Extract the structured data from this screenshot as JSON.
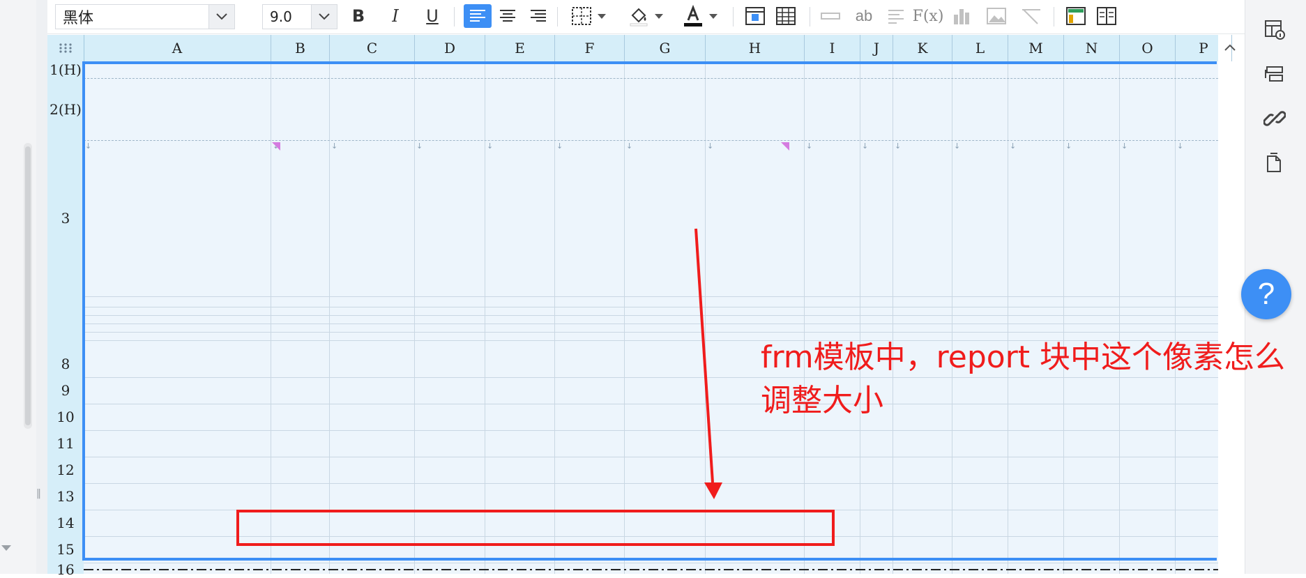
{
  "toolbar": {
    "font_family": "黑体",
    "font_size": "9.0",
    "buttons": [
      "bold",
      "italic",
      "underline",
      "align-left",
      "align-center",
      "align-right",
      "border",
      "fill-color",
      "font-color",
      "insert-cell",
      "table-grid",
      "merge",
      "text",
      "paragraph",
      "formula",
      "chart",
      "image",
      "slash",
      "layout-a",
      "layout-b"
    ]
  },
  "colors": {
    "accent": "#3d8ff5",
    "annotation": "#f01c1c",
    "header_bg": "#d6eef9",
    "cell_bg": "#edf5fc"
  },
  "grid": {
    "columns": [
      "A",
      "B",
      "C",
      "D",
      "E",
      "F",
      "G",
      "H",
      "I",
      "J",
      "K",
      "L",
      "M",
      "N",
      "O",
      "P"
    ],
    "rows": [
      "1(H)",
      "2(H)",
      "3",
      "8",
      "9",
      "10",
      "11",
      "12",
      "13",
      "14",
      "15",
      "16"
    ]
  },
  "annotation": {
    "text": "frm模板中，report 块中这个像素怎么调整大小"
  },
  "help": {
    "label": "?"
  },
  "right_panel": {
    "icons": [
      "cell-attribute-icon",
      "widget-settings-icon",
      "hyperlink-icon",
      "page-settings-icon"
    ]
  }
}
